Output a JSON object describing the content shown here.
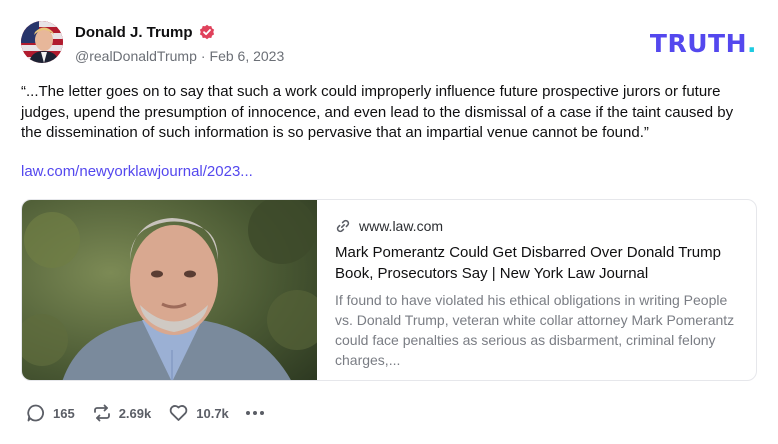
{
  "post": {
    "author": {
      "display_name": "Donald J. Trump",
      "handle": "@realDonaldTrump",
      "separator": "·",
      "date": "Feb 6, 2023",
      "verified": true
    },
    "brand": {
      "name": "TRUTH",
      "dot": "."
    },
    "text": "“...The letter goes on to say that such a work could improperly influence future prospective jurors or future judges, upend the presumption of innocence, and even lead to the dismissal of a case if the taint caused by the dissemination of such information is so pervasive that an impartial venue cannot be found.”",
    "link_text": "law.com/newyorklawjournal/2023...",
    "card": {
      "domain": "www.law.com",
      "title": "Mark Pomerantz Could Get Disbarred Over Donald Trump Book, Prosecutors Say | New York Law Journal",
      "description": "If found to have violated his ethical obligations in writing People vs. Donald Trump, veteran white collar attorney Mark Pomerantz could face penalties as serious as disbarment, criminal felony charges,..."
    },
    "actions": {
      "replies": "165",
      "retruths": "2.69k",
      "likes": "10.7k"
    }
  },
  "colors": {
    "brand": "#5448ee",
    "brand_dot": "#1ecbe1",
    "verified": "#e0415b",
    "link": "#5448ee",
    "muted": "#6b6f76"
  },
  "icons": {
    "verified": "verified-badge-icon",
    "link": "link-chain-icon",
    "reply": "reply-bubble-icon",
    "retruth": "retruth-arrows-icon",
    "like": "heart-icon",
    "more": "more-dots-icon"
  }
}
